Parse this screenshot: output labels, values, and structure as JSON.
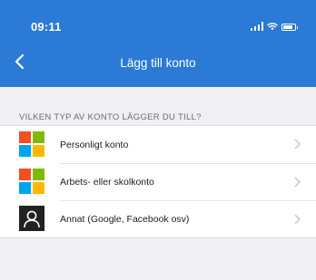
{
  "status_bar": {
    "time": "09:11"
  },
  "nav": {
    "title": "Lägg till konto",
    "back_icon": "chevron-left-icon"
  },
  "section": {
    "header": "VILKEN TYP AV KONTO LÄGGER DU TILL?"
  },
  "accounts": [
    {
      "label": "Personligt konto",
      "icon": "microsoft-logo-icon"
    },
    {
      "label": "Arbets- eller skolkonto",
      "icon": "microsoft-logo-icon"
    },
    {
      "label": "Annat (Google, Facebook osv)",
      "icon": "person-icon"
    }
  ],
  "colors": {
    "header_bg": "#2a7ad6",
    "page_bg": "#efeff4",
    "ms_red": "#f25022",
    "ms_green": "#7fba00",
    "ms_blue": "#00a4ef",
    "ms_yellow": "#ffb900",
    "chevron": "#c7c7cc"
  }
}
